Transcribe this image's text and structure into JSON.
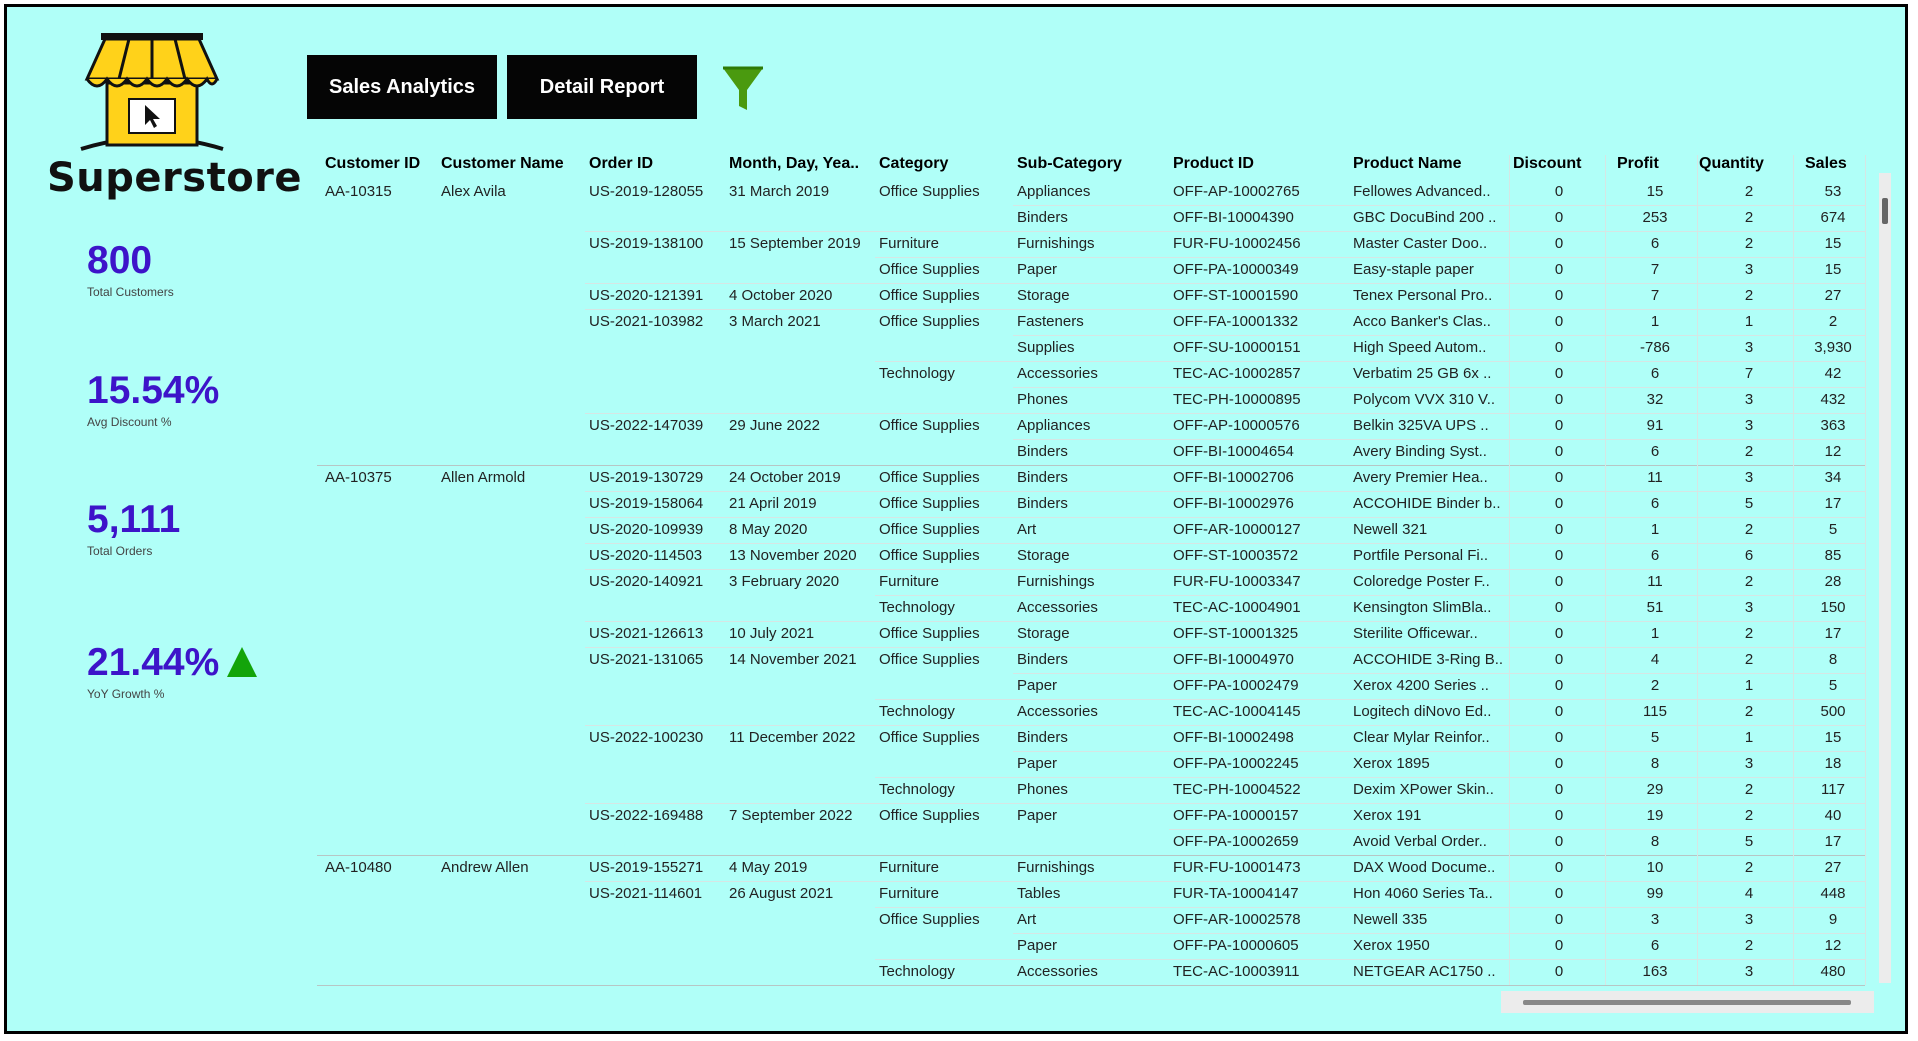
{
  "brand": {
    "name": "Superstore"
  },
  "nav": {
    "sales_analytics": "Sales Analytics",
    "detail_report": "Detail Report"
  },
  "kpis": [
    {
      "value": "800",
      "label": "Total Customers"
    },
    {
      "value": "15.54%",
      "label": "Avg Discount %"
    },
    {
      "value": "5,111",
      "label": "Total Orders"
    },
    {
      "value": "21.44%",
      "label": "YoY Growth %",
      "trend": "up"
    }
  ],
  "colors": {
    "background": "#b0fff8",
    "kpi_value": "#3d14c9",
    "trend_up": "#13a40a",
    "button_bg": "#050505",
    "filter_icon": "#4a9a0f"
  },
  "table": {
    "headers": {
      "customer_id": "Customer ID",
      "customer_name": "Customer Name",
      "order_id": "Order ID",
      "date": "Month, Day, Yea..",
      "category": "Category",
      "subcategory": "Sub-Category",
      "product_id": "Product ID",
      "product_name": "Product Name",
      "discount": "Discount",
      "profit": "Profit",
      "quantity": "Quantity",
      "sales": "Sales"
    },
    "rows": [
      {
        "cid": "AA-10315",
        "cname": "Alex Avila",
        "oid": "US-2019-128055",
        "date": "31 March 2019",
        "cat": "Office Supplies",
        "sub": "Appliances",
        "pid": "OFF-AP-10002765",
        "pname": "Fellowes Advanced..",
        "disc": "0",
        "profit": "15",
        "qty": "2",
        "sales": "53"
      },
      {
        "cid": "",
        "cname": "",
        "oid": "",
        "date": "",
        "cat": "",
        "sub": "Binders",
        "pid": "OFF-BI-10004390",
        "pname": "GBC DocuBind 200 ..",
        "disc": "0",
        "profit": "253",
        "qty": "2",
        "sales": "674"
      },
      {
        "cid": "",
        "cname": "",
        "oid": "US-2019-138100",
        "date": "15 September 2019",
        "cat": "Furniture",
        "sub": "Furnishings",
        "pid": "FUR-FU-10002456",
        "pname": "Master Caster Doo..",
        "disc": "0",
        "profit": "6",
        "qty": "2",
        "sales": "15"
      },
      {
        "cid": "",
        "cname": "",
        "oid": "",
        "date": "",
        "cat": "Office Supplies",
        "sub": "Paper",
        "pid": "OFF-PA-10000349",
        "pname": "Easy-staple paper",
        "disc": "0",
        "profit": "7",
        "qty": "3",
        "sales": "15"
      },
      {
        "cid": "",
        "cname": "",
        "oid": "US-2020-121391",
        "date": "4 October 2020",
        "cat": "Office Supplies",
        "sub": "Storage",
        "pid": "OFF-ST-10001590",
        "pname": "Tenex Personal Pro..",
        "disc": "0",
        "profit": "7",
        "qty": "2",
        "sales": "27"
      },
      {
        "cid": "",
        "cname": "",
        "oid": "US-2021-103982",
        "date": "3 March 2021",
        "cat": "Office Supplies",
        "sub": "Fasteners",
        "pid": "OFF-FA-10001332",
        "pname": "Acco Banker's Clas..",
        "disc": "0",
        "profit": "1",
        "qty": "1",
        "sales": "2"
      },
      {
        "cid": "",
        "cname": "",
        "oid": "",
        "date": "",
        "cat": "",
        "sub": "Supplies",
        "pid": "OFF-SU-10000151",
        "pname": "High Speed Autom..",
        "disc": "0",
        "profit": "-786",
        "qty": "3",
        "sales": "3,930"
      },
      {
        "cid": "",
        "cname": "",
        "oid": "",
        "date": "",
        "cat": "Technology",
        "sub": "Accessories",
        "pid": "TEC-AC-10002857",
        "pname": "Verbatim 25 GB 6x ..",
        "disc": "0",
        "profit": "6",
        "qty": "7",
        "sales": "42"
      },
      {
        "cid": "",
        "cname": "",
        "oid": "",
        "date": "",
        "cat": "",
        "sub": "Phones",
        "pid": "TEC-PH-10000895",
        "pname": "Polycom VVX 310 V..",
        "disc": "0",
        "profit": "32",
        "qty": "3",
        "sales": "432"
      },
      {
        "cid": "",
        "cname": "",
        "oid": "US-2022-147039",
        "date": "29 June 2022",
        "cat": "Office Supplies",
        "sub": "Appliances",
        "pid": "OFF-AP-10000576",
        "pname": "Belkin 325VA UPS ..",
        "disc": "0",
        "profit": "91",
        "qty": "3",
        "sales": "363"
      },
      {
        "cid": "",
        "cname": "",
        "oid": "",
        "date": "",
        "cat": "",
        "sub": "Binders",
        "pid": "OFF-BI-10004654",
        "pname": "Avery Binding Syst..",
        "disc": "0",
        "profit": "6",
        "qty": "2",
        "sales": "12"
      },
      {
        "cid": "AA-10375",
        "cname": "Allen Armold",
        "oid": "US-2019-130729",
        "date": "24 October 2019",
        "cat": "Office Supplies",
        "sub": "Binders",
        "pid": "OFF-BI-10002706",
        "pname": "Avery Premier Hea..",
        "disc": "0",
        "profit": "11",
        "qty": "3",
        "sales": "34"
      },
      {
        "cid": "",
        "cname": "",
        "oid": "US-2019-158064",
        "date": "21 April 2019",
        "cat": "Office Supplies",
        "sub": "Binders",
        "pid": "OFF-BI-10002976",
        "pname": "ACCOHIDE Binder b..",
        "disc": "0",
        "profit": "6",
        "qty": "5",
        "sales": "17"
      },
      {
        "cid": "",
        "cname": "",
        "oid": "US-2020-109939",
        "date": "8 May 2020",
        "cat": "Office Supplies",
        "sub": "Art",
        "pid": "OFF-AR-10000127",
        "pname": "Newell 321",
        "disc": "0",
        "profit": "1",
        "qty": "2",
        "sales": "5"
      },
      {
        "cid": "",
        "cname": "",
        "oid": "US-2020-114503",
        "date": "13 November 2020",
        "cat": "Office Supplies",
        "sub": "Storage",
        "pid": "OFF-ST-10003572",
        "pname": "Portfile Personal Fi..",
        "disc": "0",
        "profit": "6",
        "qty": "6",
        "sales": "85"
      },
      {
        "cid": "",
        "cname": "",
        "oid": "US-2020-140921",
        "date": "3 February 2020",
        "cat": "Furniture",
        "sub": "Furnishings",
        "pid": "FUR-FU-10003347",
        "pname": "Coloredge Poster F..",
        "disc": "0",
        "profit": "11",
        "qty": "2",
        "sales": "28"
      },
      {
        "cid": "",
        "cname": "",
        "oid": "",
        "date": "",
        "cat": "Technology",
        "sub": "Accessories",
        "pid": "TEC-AC-10004901",
        "pname": "Kensington SlimBla..",
        "disc": "0",
        "profit": "51",
        "qty": "3",
        "sales": "150"
      },
      {
        "cid": "",
        "cname": "",
        "oid": "US-2021-126613",
        "date": "10 July 2021",
        "cat": "Office Supplies",
        "sub": "Storage",
        "pid": "OFF-ST-10001325",
        "pname": "Sterilite Officewar..",
        "disc": "0",
        "profit": "1",
        "qty": "2",
        "sales": "17"
      },
      {
        "cid": "",
        "cname": "",
        "oid": "US-2021-131065",
        "date": "14 November 2021",
        "cat": "Office Supplies",
        "sub": "Binders",
        "pid": "OFF-BI-10004970",
        "pname": "ACCOHIDE 3-Ring B..",
        "disc": "0",
        "profit": "4",
        "qty": "2",
        "sales": "8"
      },
      {
        "cid": "",
        "cname": "",
        "oid": "",
        "date": "",
        "cat": "",
        "sub": "Paper",
        "pid": "OFF-PA-10002479",
        "pname": "Xerox 4200 Series ..",
        "disc": "0",
        "profit": "2",
        "qty": "1",
        "sales": "5"
      },
      {
        "cid": "",
        "cname": "",
        "oid": "",
        "date": "",
        "cat": "Technology",
        "sub": "Accessories",
        "pid": "TEC-AC-10004145",
        "pname": "Logitech diNovo Ed..",
        "disc": "0",
        "profit": "115",
        "qty": "2",
        "sales": "500"
      },
      {
        "cid": "",
        "cname": "",
        "oid": "US-2022-100230",
        "date": "11 December 2022",
        "cat": "Office Supplies",
        "sub": "Binders",
        "pid": "OFF-BI-10002498",
        "pname": "Clear Mylar Reinfor..",
        "disc": "0",
        "profit": "5",
        "qty": "1",
        "sales": "15"
      },
      {
        "cid": "",
        "cname": "",
        "oid": "",
        "date": "",
        "cat": "",
        "sub": "Paper",
        "pid": "OFF-PA-10002245",
        "pname": "Xerox 1895",
        "disc": "0",
        "profit": "8",
        "qty": "3",
        "sales": "18"
      },
      {
        "cid": "",
        "cname": "",
        "oid": "",
        "date": "",
        "cat": "Technology",
        "sub": "Phones",
        "pid": "TEC-PH-10004522",
        "pname": "Dexim XPower Skin..",
        "disc": "0",
        "profit": "29",
        "qty": "2",
        "sales": "117"
      },
      {
        "cid": "",
        "cname": "",
        "oid": "US-2022-169488",
        "date": "7 September 2022",
        "cat": "Office Supplies",
        "sub": "Paper",
        "pid": "OFF-PA-10000157",
        "pname": "Xerox 191",
        "disc": "0",
        "profit": "19",
        "qty": "2",
        "sales": "40"
      },
      {
        "cid": "",
        "cname": "",
        "oid": "",
        "date": "",
        "cat": "",
        "sub": "",
        "pid": "OFF-PA-10002659",
        "pname": "Avoid Verbal Order..",
        "disc": "0",
        "profit": "8",
        "qty": "5",
        "sales": "17"
      },
      {
        "cid": "AA-10480",
        "cname": "Andrew Allen",
        "oid": "US-2019-155271",
        "date": "4 May 2019",
        "cat": "Furniture",
        "sub": "Furnishings",
        "pid": "FUR-FU-10001473",
        "pname": "DAX Wood Docume..",
        "disc": "0",
        "profit": "10",
        "qty": "2",
        "sales": "27"
      },
      {
        "cid": "",
        "cname": "",
        "oid": "US-2021-114601",
        "date": "26 August 2021",
        "cat": "Furniture",
        "sub": "Tables",
        "pid": "FUR-TA-10004147",
        "pname": "Hon 4060 Series Ta..",
        "disc": "0",
        "profit": "99",
        "qty": "4",
        "sales": "448"
      },
      {
        "cid": "",
        "cname": "",
        "oid": "",
        "date": "",
        "cat": "Office Supplies",
        "sub": "Art",
        "pid": "OFF-AR-10002578",
        "pname": "Newell 335",
        "disc": "0",
        "profit": "3",
        "qty": "3",
        "sales": "9"
      },
      {
        "cid": "",
        "cname": "",
        "oid": "",
        "date": "",
        "cat": "",
        "sub": "Paper",
        "pid": "OFF-PA-10000605",
        "pname": "Xerox 1950",
        "disc": "0",
        "profit": "6",
        "qty": "2",
        "sales": "12"
      },
      {
        "cid": "",
        "cname": "",
        "oid": "",
        "date": "",
        "cat": "Technology",
        "sub": "Accessories",
        "pid": "TEC-AC-10003911",
        "pname": "NETGEAR AC1750 ..",
        "disc": "0",
        "profit": "163",
        "qty": "3",
        "sales": "480"
      }
    ]
  }
}
